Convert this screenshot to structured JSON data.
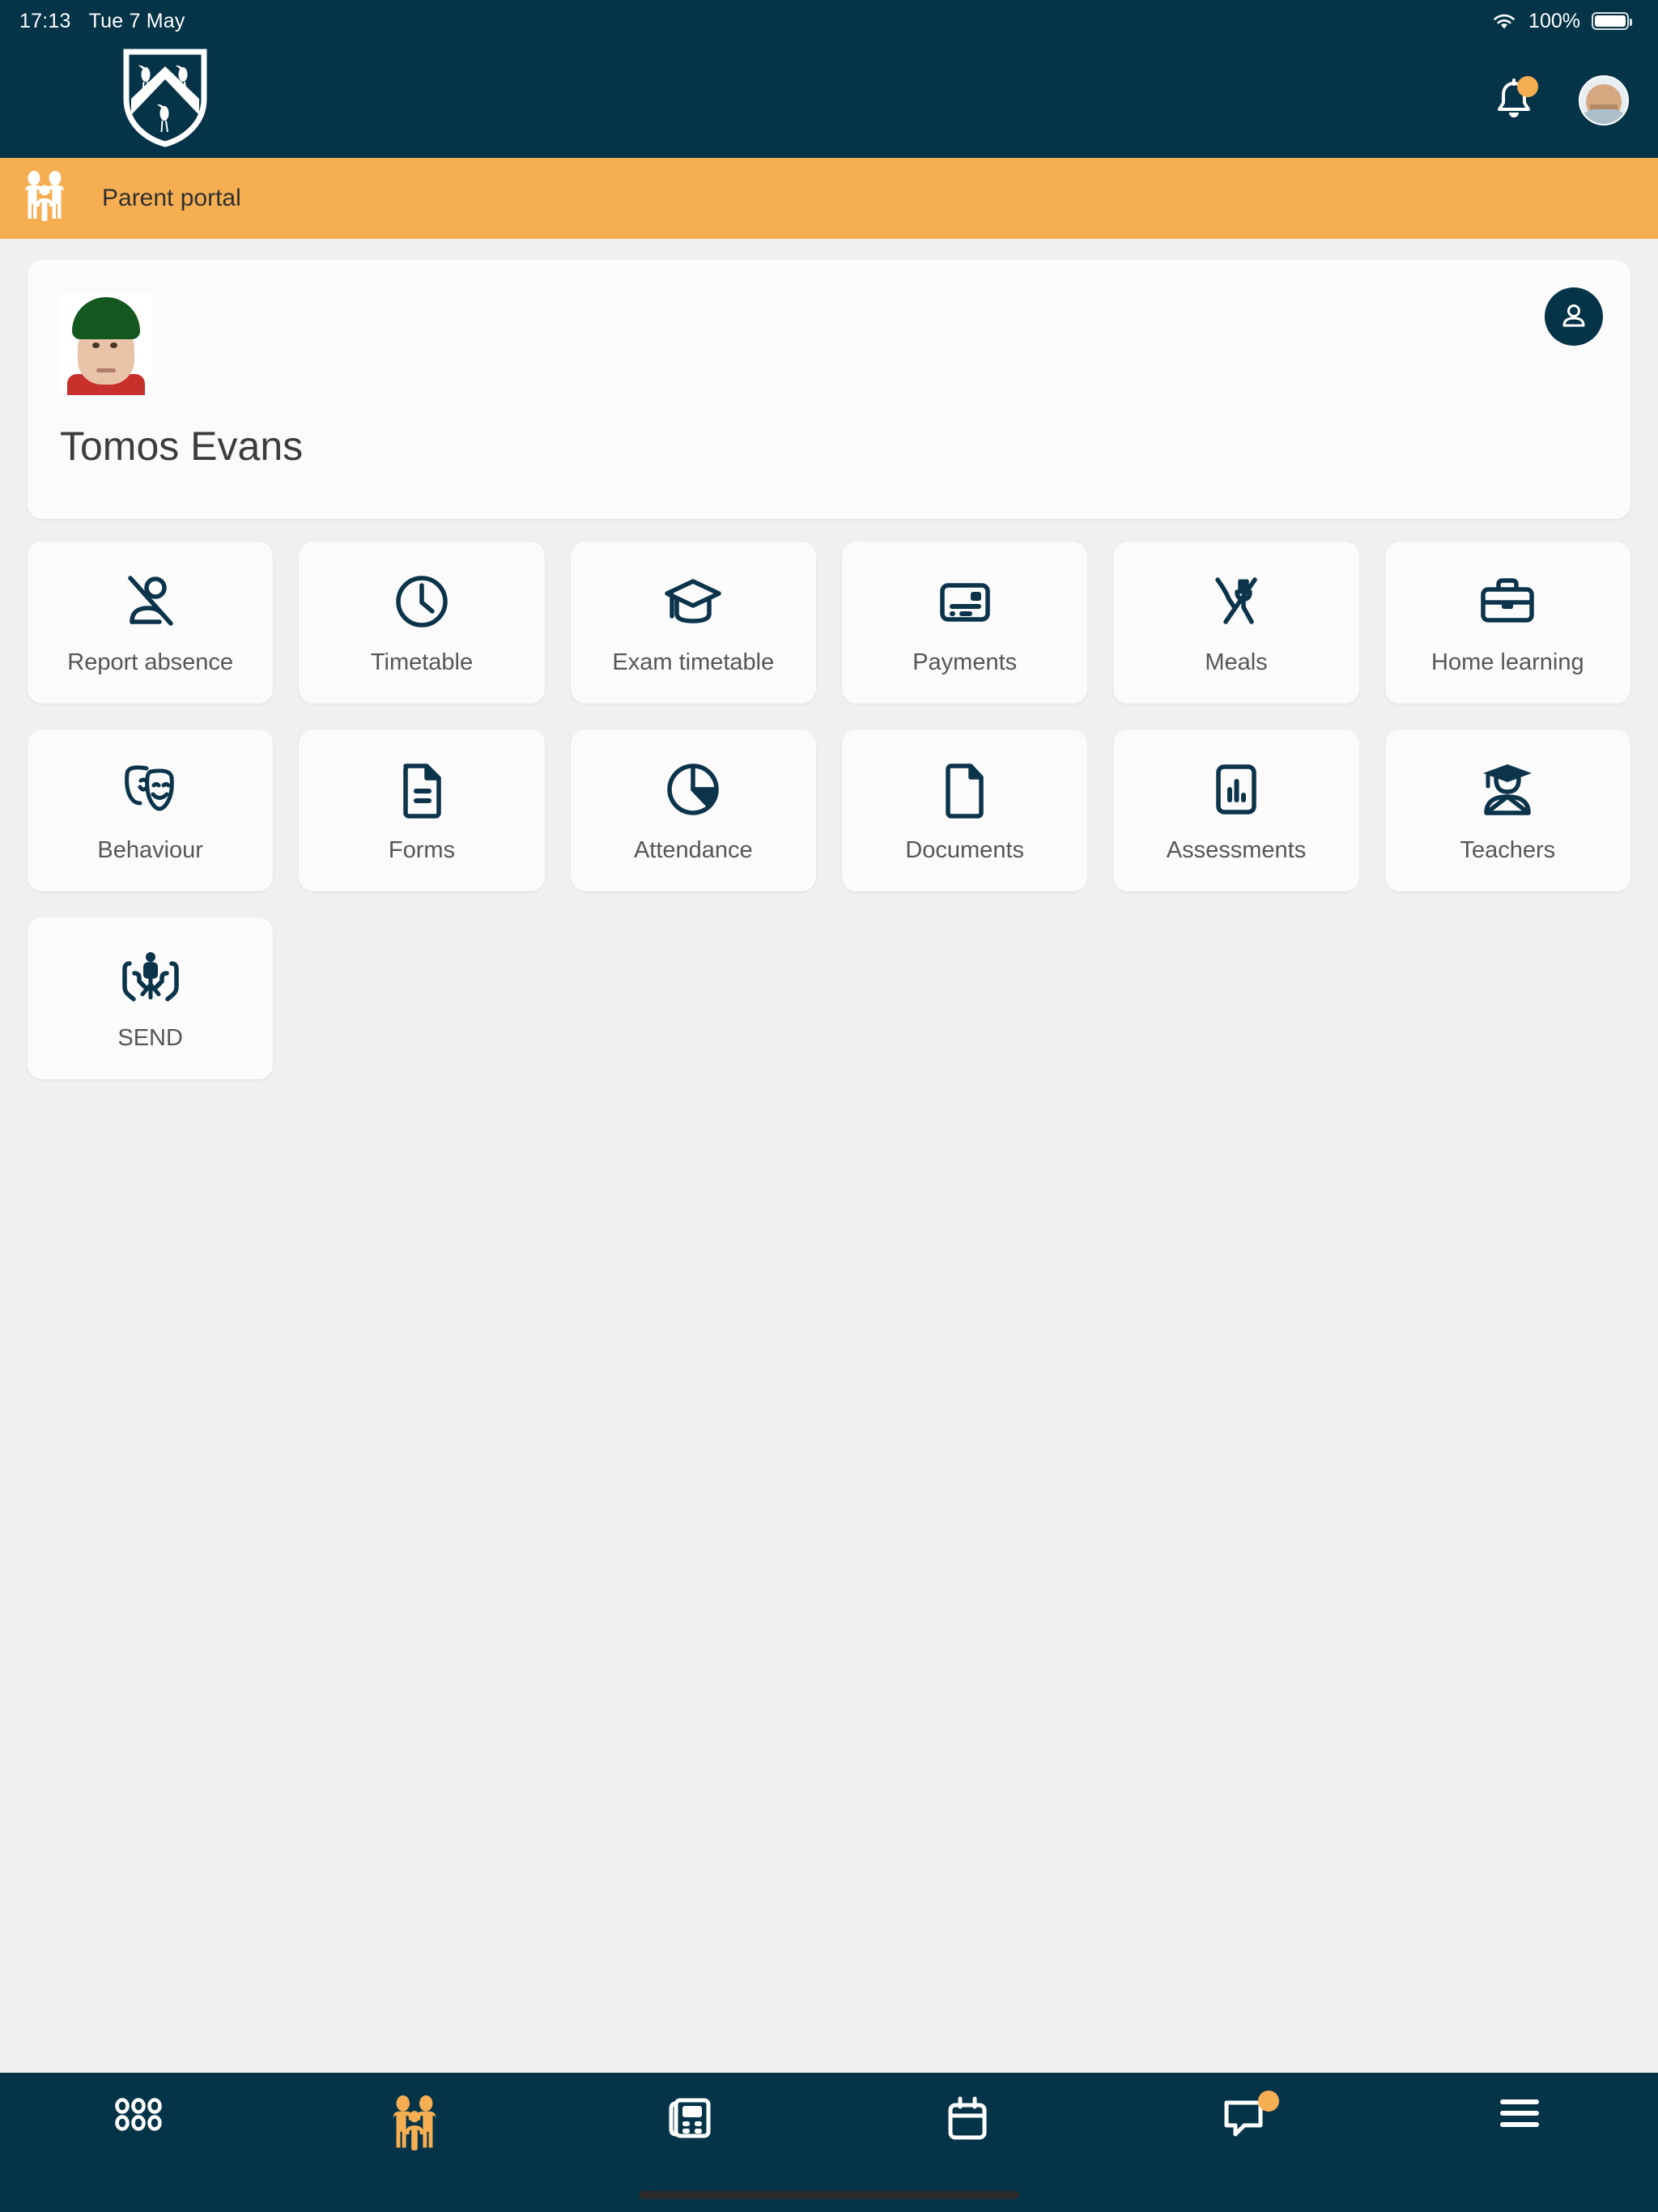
{
  "status_bar": {
    "time": "17:13",
    "date": "Tue 7 May",
    "battery_percent": "100%",
    "wifi_icon": "wifi-icon",
    "battery_icon": "battery-icon"
  },
  "header": {
    "logo_icon": "school-crest-logo",
    "bell_icon": "bell-icon",
    "bell_has_notification": true,
    "avatar_icon": "user-avatar",
    "background_color": "#053347"
  },
  "portal_bar": {
    "icon": "family-icon",
    "label": "Parent portal",
    "background_color": "#F5AF52"
  },
  "student_card": {
    "photo_icon": "student-photo",
    "name": "Tomos Evans",
    "switch_student_icon": "person-icon"
  },
  "tiles": [
    {
      "label": "Report absence",
      "icon": "person-absent-icon"
    },
    {
      "label": "Timetable",
      "icon": "clock-icon"
    },
    {
      "label": "Exam timetable",
      "icon": "graduation-cap-icon"
    },
    {
      "label": "Payments",
      "icon": "payment-card-icon"
    },
    {
      "label": "Meals",
      "icon": "cutlery-icon"
    },
    {
      "label": "Home learning",
      "icon": "briefcase-icon"
    },
    {
      "label": "Behaviour",
      "icon": "theatre-masks-icon"
    },
    {
      "label": "Forms",
      "icon": "document-lines-icon"
    },
    {
      "label": "Attendance",
      "icon": "pie-chart-icon"
    },
    {
      "label": "Documents",
      "icon": "document-icon"
    },
    {
      "label": "Assessments",
      "icon": "bar-chart-icon"
    },
    {
      "label": "Teachers",
      "icon": "graduate-person-icon"
    },
    {
      "label": "SEND",
      "icon": "child-in-hands-icon"
    }
  ],
  "bottom_nav": [
    {
      "icon": "grid-dots-icon",
      "active": false,
      "badge": false
    },
    {
      "icon": "family-icon",
      "active": true,
      "badge": false
    },
    {
      "icon": "newspaper-icon",
      "active": false,
      "badge": false
    },
    {
      "icon": "calendar-icon",
      "active": false,
      "badge": false
    },
    {
      "icon": "message-icon",
      "active": false,
      "badge": true
    },
    {
      "icon": "hamburger-menu-icon",
      "active": false,
      "badge": false
    }
  ],
  "colors": {
    "brand_navy": "#053347",
    "accent_orange": "#F5AF52",
    "page_background": "#f0f0f0",
    "tile_background": "#fbfbfb"
  }
}
